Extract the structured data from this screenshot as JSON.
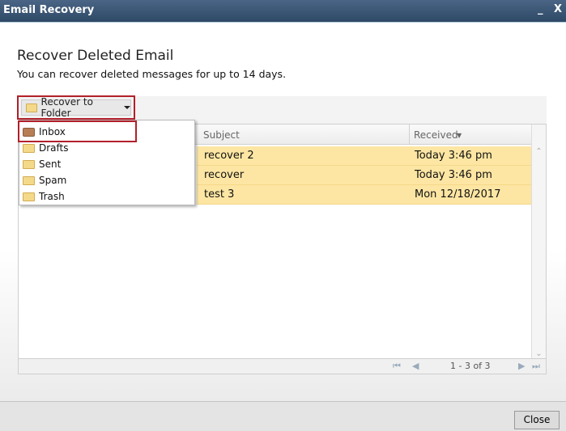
{
  "window": {
    "title": "Email Recovery",
    "minimize": "_",
    "close": "X"
  },
  "heading": "Recover Deleted Email",
  "subtitle": "You can recover deleted messages for up to 14 days.",
  "toolbar": {
    "recover_label": "Recover to Folder"
  },
  "menu": {
    "items": [
      {
        "label": "Inbox",
        "icon": "inbox-icon"
      },
      {
        "label": "Drafts",
        "icon": "folder-icon"
      },
      {
        "label": "Sent",
        "icon": "folder-icon"
      },
      {
        "label": "Spam",
        "icon": "folder-icon"
      },
      {
        "label": "Trash",
        "icon": "folder-icon"
      }
    ]
  },
  "grid": {
    "columns": {
      "subject": "Subject",
      "received": "Received"
    },
    "rows": [
      {
        "subject": "recover 2",
        "received": "Today 3:46 pm"
      },
      {
        "subject": "recover",
        "received": "Today 3:46 pm"
      },
      {
        "subject": "test 3",
        "received": "Mon 12/18/2017"
      }
    ],
    "selected_row_color": "#fde6a3"
  },
  "pager": {
    "text": "1 - 3 of 3"
  },
  "footer": {
    "close_label": "Close"
  }
}
